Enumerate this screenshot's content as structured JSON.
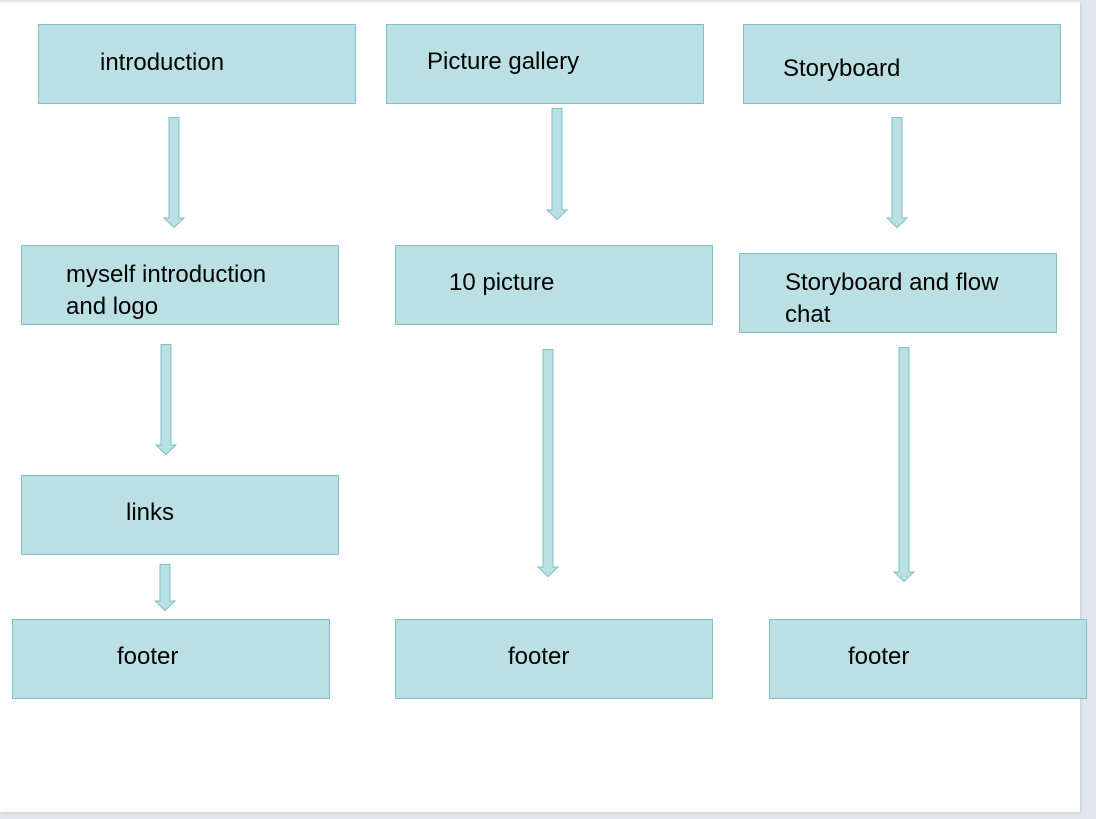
{
  "colors": {
    "box_fill": "#bbe0e3",
    "box_border": "#7fc1c6",
    "arrow_fill": "#bbe0e3"
  },
  "columns": [
    {
      "name": "introduction",
      "boxes": [
        "introduction",
        "myself introduction and logo",
        "links",
        "footer"
      ],
      "lines": {
        "b0": [
          "introduction"
        ],
        "b1": [
          "myself introduction",
          "and logo"
        ],
        "b2": [
          "links"
        ],
        "b3": [
          "footer"
        ]
      }
    },
    {
      "name": "Picture gallery",
      "boxes": [
        "Picture gallery",
        "10 picture",
        "footer"
      ],
      "lines": {
        "b0": [
          "Picture gallery"
        ],
        "b1": [
          "10 picture"
        ],
        "b2": [
          "footer"
        ]
      }
    },
    {
      "name": "Storyboard",
      "boxes": [
        "Storyboard",
        "Storyboard and flow chat",
        "footer"
      ],
      "lines": {
        "b0": [
          "Storyboard"
        ],
        "b1": [
          "Storyboard and flow",
          "chat"
        ],
        "b2": [
          "footer"
        ]
      }
    }
  ]
}
